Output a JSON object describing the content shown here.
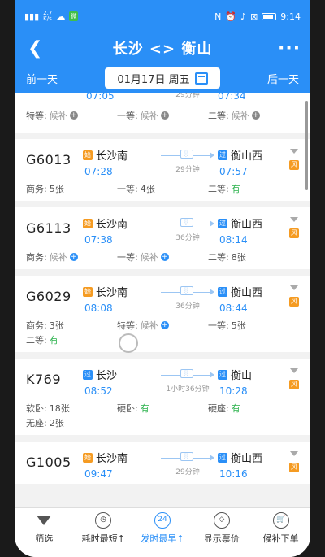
{
  "status": {
    "signal": "\u0000",
    "speed_num": "2.7",
    "speed_unit": "K/s",
    "wechat_badge": "•",
    "vpn": "4G",
    "battery": "",
    "time": "9:14"
  },
  "header": {
    "title": "长沙 <> 衡山",
    "date": "01月17日 周五",
    "prev_day": "前一天",
    "next_day": "后一天"
  },
  "partial": {
    "dep_time": "07:05",
    "duration": "29分钟",
    "arr_time": "07:34",
    "seats": [
      {
        "label": "特等:",
        "value": "候补",
        "kind": "gray-plus"
      },
      {
        "label": "一等:",
        "value": "候补",
        "kind": "gray-plus"
      },
      {
        "label": "二等:",
        "value": "候补",
        "kind": "gray-plus"
      }
    ]
  },
  "trains": [
    {
      "no": "G6013",
      "from_tag": "始",
      "from": "长沙南",
      "dep": "07:28",
      "duration": "29分钟",
      "to_tag": "过",
      "to": "衡山西",
      "arr": "07:57",
      "fu": "风",
      "seats": [
        {
          "label": "商务:",
          "value": "5张",
          "kind": "dark"
        },
        {
          "label": "一等:",
          "value": "4张",
          "kind": "dark"
        },
        {
          "label": "二等:",
          "value": "有",
          "kind": "green"
        }
      ]
    },
    {
      "no": "G6113",
      "from_tag": "始",
      "from": "长沙南",
      "dep": "07:38",
      "duration": "36分钟",
      "to_tag": "过",
      "to": "衡山西",
      "arr": "08:14",
      "fu": "风",
      "seats": [
        {
          "label": "商务:",
          "value": "候补",
          "kind": "blue-plus"
        },
        {
          "label": "一等:",
          "value": "候补",
          "kind": "blue-plus"
        },
        {
          "label": "二等:",
          "value": "8张",
          "kind": "dark"
        }
      ]
    },
    {
      "no": "G6029",
      "from_tag": "始",
      "from": "长沙南",
      "dep": "08:08",
      "duration": "36分钟",
      "to_tag": "过",
      "to": "衡山西",
      "arr": "08:44",
      "fu": "风",
      "seats": [
        {
          "label": "商务:",
          "value": "3张",
          "kind": "dark"
        },
        {
          "label": "特等:",
          "value": "候补",
          "kind": "blue-plus"
        },
        {
          "label": "一等:",
          "value": "5张",
          "kind": "dark"
        },
        {
          "label": "二等:",
          "value": "有",
          "kind": "green"
        }
      ]
    },
    {
      "no": "K769",
      "from_tag": "过",
      "from": "长沙",
      "dep": "08:52",
      "duration": "1小时36分钟",
      "to_tag": "过",
      "to": "衡山",
      "arr": "10:28",
      "fu": "风",
      "seats": [
        {
          "label": "软卧:",
          "value": "18张",
          "kind": "dark"
        },
        {
          "label": "硬卧:",
          "value": "有",
          "kind": "green"
        },
        {
          "label": "硬座:",
          "value": "有",
          "kind": "green"
        },
        {
          "label": "无座:",
          "value": "2张",
          "kind": "dark"
        }
      ]
    },
    {
      "no": "G1005",
      "from_tag": "始",
      "from": "长沙南",
      "dep": "09:47",
      "duration": "29分钟",
      "to_tag": "过",
      "to": "衡山西",
      "arr": "10:16",
      "fu": "风",
      "seats": []
    }
  ],
  "tabs": [
    {
      "label": "筛选",
      "icon": "filter-icon"
    },
    {
      "label": "耗时最短↑",
      "icon": "timer-icon"
    },
    {
      "label": "发时最早↑",
      "icon": "clock-24-icon",
      "active": true
    },
    {
      "label": "显示票价",
      "icon": "price-tag-icon"
    },
    {
      "label": "候补下单",
      "icon": "cart-icon"
    }
  ]
}
